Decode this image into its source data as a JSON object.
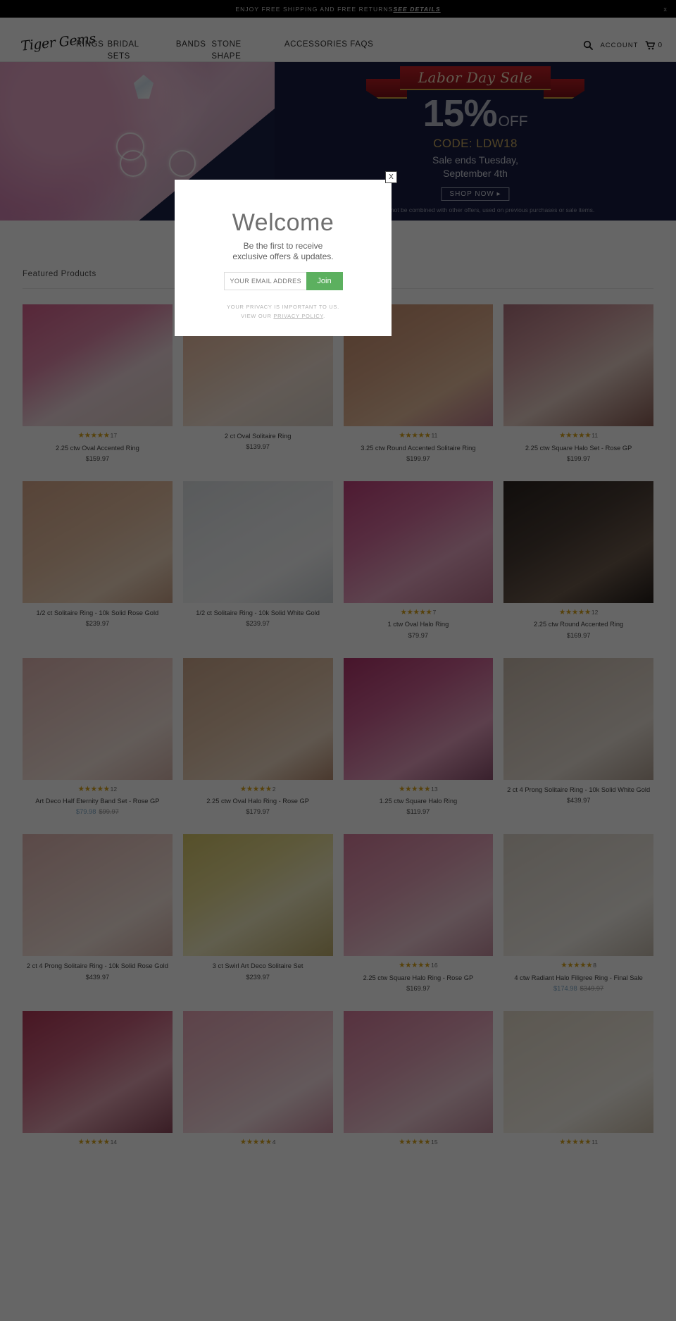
{
  "announcement": {
    "message": "ENJOY FREE SHIPPING AND FREE RETURNS",
    "details_link": "SEE DETAILS",
    "close_label": "x"
  },
  "header": {
    "logo_text": "Tiger Gems",
    "nav": [
      {
        "label": "RINGS"
      },
      {
        "label": "BRIDAL",
        "line2": "SETS"
      },
      {
        "label": "BANDS"
      },
      {
        "label": "STONE",
        "line2": "SHAPE"
      },
      {
        "label": "ACCESSORIES"
      },
      {
        "label": "FAQS"
      }
    ],
    "search_icon": "search-icon",
    "account_label": "ACCOUNT",
    "cart_icon": "cart-icon",
    "cart_count": "0"
  },
  "hero": {
    "ribbon_text": "Labor Day Sale",
    "percent": "15%",
    "off": "OFF",
    "code": "CODE: LDW18",
    "subline": "Sale ends Tuesday,\nSeptember 4th",
    "button_label": "SHOP NOW ▸",
    "fine_print": "Discount cannot be combined with other offers, used on previous purchases or sale items."
  },
  "featured": {
    "title": "Featured Products",
    "products": [
      {
        "name": "2.25 ctw Oval Accented Ring",
        "price": "$159.97",
        "rating": 5,
        "reviews": "17",
        "img": "t-pink"
      },
      {
        "name": "2 ct Oval Solitaire Ring",
        "price": "$139.97",
        "rating": 0,
        "reviews": "",
        "img": "t-peach"
      },
      {
        "name": "3.25 ctw Round Accented Solitaire Ring",
        "price": "$199.97",
        "rating": 5,
        "reviews": "11",
        "img": "t-hand"
      },
      {
        "name": "2.25 ctw Square Halo Set - Rose GP",
        "price": "$199.97",
        "rating": 5,
        "reviews": "11",
        "img": "t-rose"
      },
      {
        "name": "1/2 ct Solitaire Ring - 10k Solid Rose Gold",
        "price": "$239.97",
        "rating": 0,
        "reviews": "",
        "img": "t-hand2"
      },
      {
        "name": "1/2 ct Solitaire Ring - 10k Solid White Gold",
        "price": "$239.97",
        "rating": 0,
        "reviews": "",
        "img": "t-white"
      },
      {
        "name": "1 ctw Oval Halo Ring",
        "price": "$79.97",
        "rating": 5,
        "reviews": "7",
        "img": "t-fuch"
      },
      {
        "name": "2.25 ctw Round Accented Ring",
        "price": "$169.97",
        "rating": 5,
        "reviews": "12",
        "img": "t-dark"
      },
      {
        "name": "Art Deco Half Eternity Band Set - Rose GP",
        "sale_price": "$79.98",
        "was_price": "$99.97",
        "rating": 5,
        "reviews": "12",
        "img": "t-blush"
      },
      {
        "name": "2.25 ctw Oval Halo Ring - Rose GP",
        "price": "$179.97",
        "rating": 5,
        "reviews": "2",
        "img": "t-nail"
      },
      {
        "name": "1.25 ctw Square Halo Ring",
        "price": "$119.97",
        "rating": 5,
        "reviews": "13",
        "img": "t-mag"
      },
      {
        "name": "2 ct 4 Prong Solitaire Ring - 10k Solid White Gold",
        "price": "$439.97",
        "rating": 0,
        "reviews": "",
        "img": "t-taupe"
      },
      {
        "name": "2 ct 4 Prong Solitaire Ring - 10k Solid Rose Gold",
        "price": "$439.97",
        "rating": 0,
        "reviews": "",
        "img": "t-blush"
      },
      {
        "name": "3 ct Swirl Art Deco Solitaire Set",
        "price": "$239.97",
        "rating": 0,
        "reviews": "",
        "img": "t-yel"
      },
      {
        "name": "2.25 ctw Square Halo Ring - Rose GP",
        "price": "$169.97",
        "rating": 5,
        "reviews": "16",
        "img": "t-pink2"
      },
      {
        "name": "4 ctw Radiant Halo Filigree Ring - Final Sale",
        "sale_price": "$174.98",
        "was_price": "$349.97",
        "rating": 5,
        "reviews": "8",
        "img": "t-ivory"
      },
      {
        "name": "",
        "price": "",
        "rating": 5,
        "reviews": "14",
        "img": "t-red"
      },
      {
        "name": "",
        "price": "",
        "rating": 5,
        "reviews": "4",
        "img": "t-rose2"
      },
      {
        "name": "",
        "price": "",
        "rating": 5,
        "reviews": "15",
        "img": "t-pink2"
      },
      {
        "name": "",
        "price": "",
        "rating": 5,
        "reviews": "11",
        "img": "t-cream"
      }
    ]
  },
  "modal": {
    "close_label": "X",
    "title": "Welcome",
    "subtitle": "Be the first to receive\nexclusive offers & updates.",
    "email_placeholder": "YOUR EMAIL ADDRESS",
    "email_value": "",
    "join_label": "Join",
    "privacy_line1": "YOUR PRIVACY IS IMPORTANT TO US.",
    "privacy_prefix": "VIEW OUR ",
    "privacy_link": "PRIVACY POLICY",
    "privacy_suffix": "."
  },
  "colors": {
    "accent_green": "#5cb05f",
    "star_gold": "#d6a21a",
    "hero_navy": "#171d42",
    "ribbon_red": "#b71c23"
  }
}
